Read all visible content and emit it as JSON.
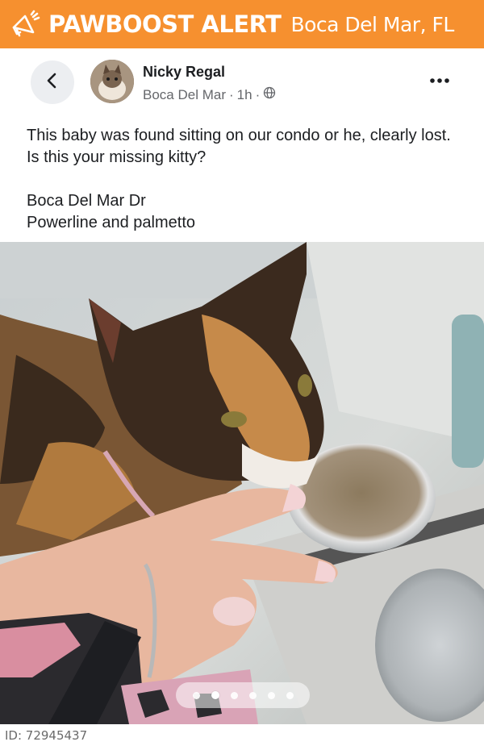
{
  "alert": {
    "brand": "PAWBOOST ALERT",
    "location": "Boca Del Mar, FL",
    "icon": "megaphone-icon",
    "bg_color": "#f6902f"
  },
  "post": {
    "back_icon": "chevron-left-icon",
    "author": "Nicky Regal",
    "group": "Boca Del Mar",
    "time": "1h",
    "separator": "·",
    "visibility_icon": "globe-icon",
    "more_icon": "more-dots-icon",
    "text_line1": "This baby was found sitting on our condo or he, clearly lost. Is this your missing kitty?",
    "text_line2": "Boca Del Mar Dr",
    "text_line3": "Powerline and palmetto"
  },
  "photo": {
    "description_icon": "found-cat-photo",
    "carousel": {
      "total": 6,
      "active_index": 1
    }
  },
  "footer": {
    "id_text": "ID: 72945437"
  }
}
